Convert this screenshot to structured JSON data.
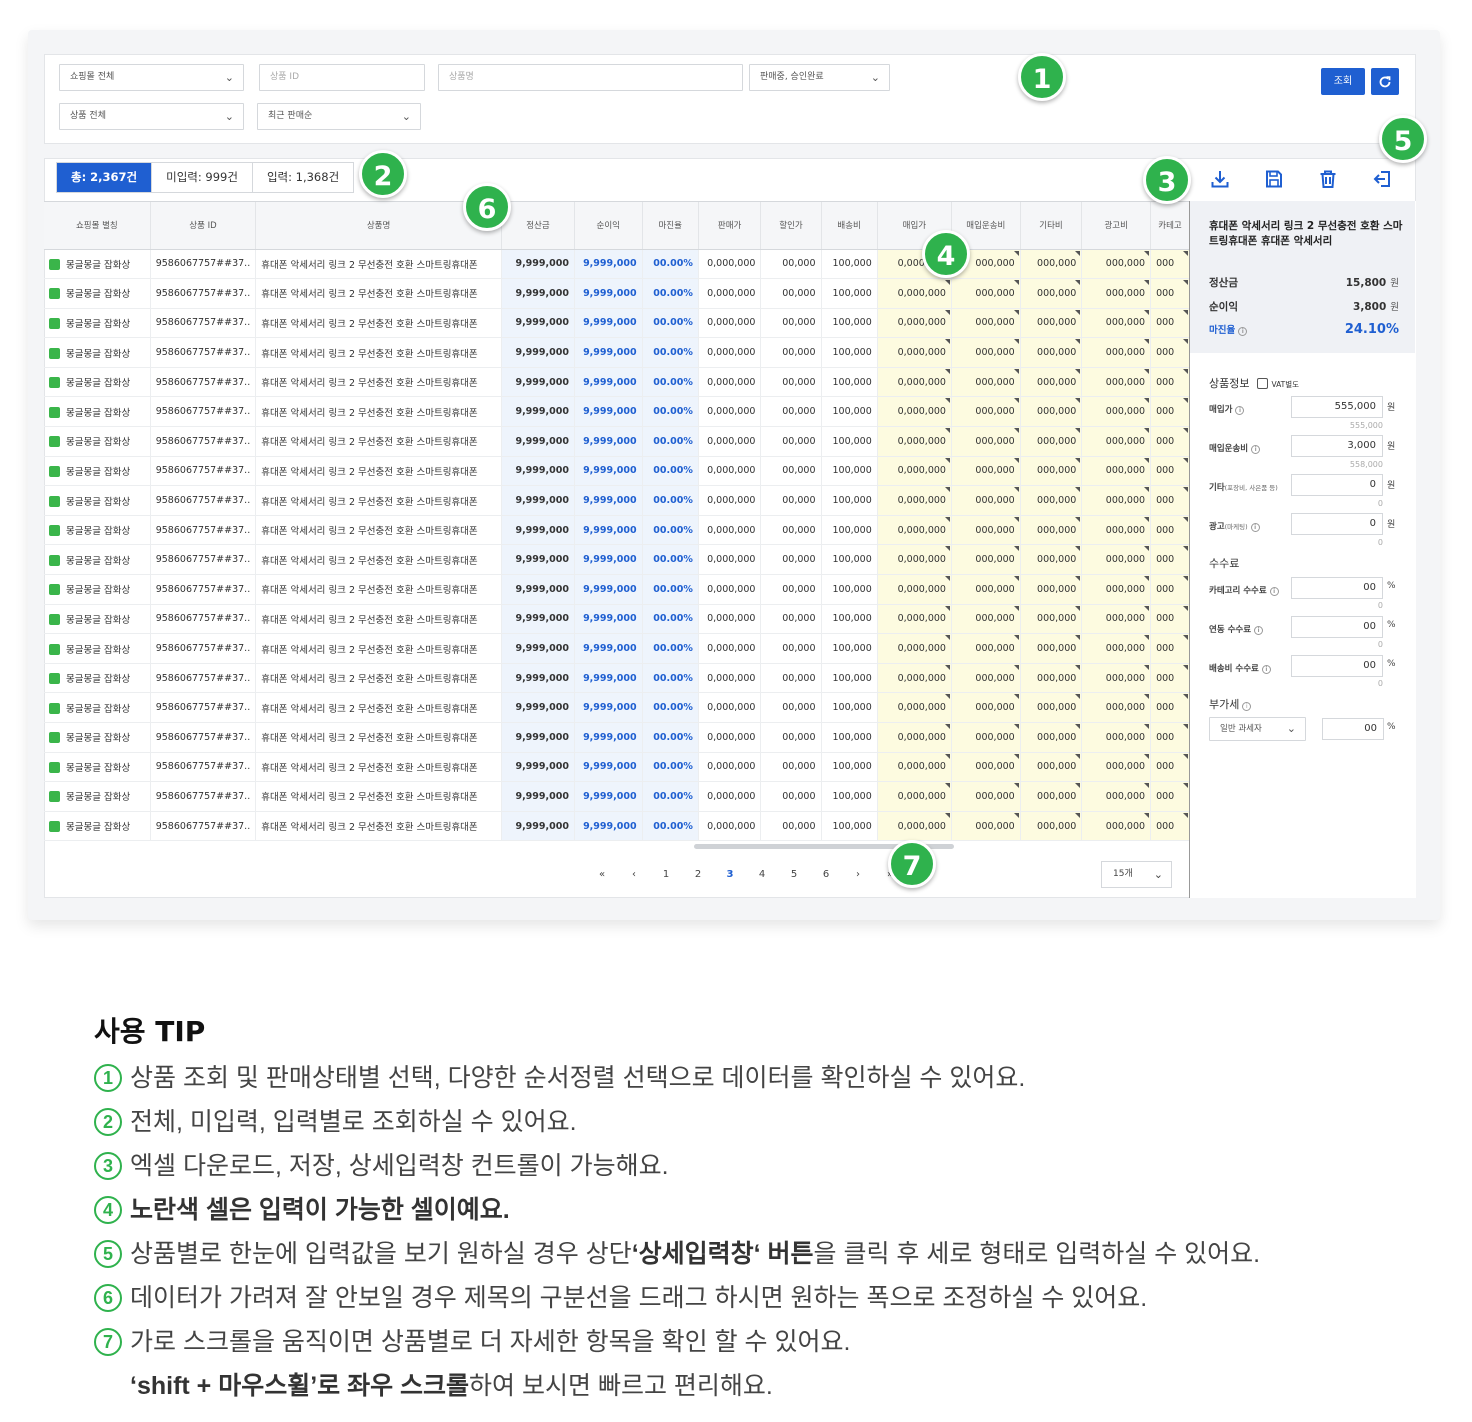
{
  "filters": {
    "mall_select": "쇼핑몰 전체",
    "product_id_placeholder": "상품 ID",
    "product_name_placeholder": "상품명",
    "status_select": "판매중, 승인완료",
    "product_select": "상품 전체",
    "sort_select": "최근 판매순",
    "search_button": "조회"
  },
  "tabs": [
    {
      "label": "총: 2,367건"
    },
    {
      "label": "미입력: 999건"
    },
    {
      "label": "입력: 1,368건"
    }
  ],
  "toolbar_icons": [
    "download-icon",
    "save-icon",
    "trash-icon",
    "detail-panel-toggle-icon"
  ],
  "table": {
    "headers": [
      "쇼핑몰 별칭",
      "상품 ID",
      "상품명",
      "정산금",
      "순이익",
      "마진율",
      "판매가",
      "할인가",
      "배송비",
      "매입가",
      "매입운송비",
      "기타비",
      "광고비",
      "카테고"
    ],
    "row": {
      "shop": "몽글몽글 잡화상",
      "pid": "9586067757##37..",
      "name": "휴대폰 악세서리 링크 2 무선충전 호환 스마트링휴대폰",
      "settle": "9,999,000",
      "profit": "9,999,000",
      "margin": "00.00%",
      "price": "0,000,000",
      "discount": "00,000",
      "ship": "100,000",
      "buy": "0,000,000",
      "buyship": "000,000",
      "etc": "000,000",
      "ad": "000,000",
      "cat": "000"
    },
    "row_count": 20
  },
  "pager": {
    "first": "«",
    "prev": "‹",
    "pages": [
      "1",
      "2",
      "3",
      "4",
      "5",
      "6"
    ],
    "current": "3",
    "next": "›",
    "last": "»",
    "page_size": "15개"
  },
  "detail": {
    "title": "휴대폰 악세서리 링크 2 무선충전 호환 스마트링휴대폰 휴대폰 악세서리",
    "settle_label": "정산금",
    "settle_value": "15,800",
    "settle_unit": "원",
    "profit_label": "순이익",
    "profit_value": "3,800",
    "profit_unit": "원",
    "margin_label": "마진율",
    "margin_value": "24.10%",
    "product_info_label": "상품정보",
    "vat_label": "VAT별도",
    "buy_label": "매입가",
    "buy_value": "555,000",
    "buy_sub": "555,000",
    "buy_unit": "원",
    "buyship_label": "매입운송비",
    "buyship_value": "3,000",
    "buyship_sub": "558,000",
    "buyship_unit": "원",
    "etc_label": "기타",
    "etc_small": "(포장비, 사은품 등)",
    "etc_value": "0",
    "etc_sub": "0",
    "etc_unit": "원",
    "ad_label": "광고",
    "ad_small": "(마케팅)",
    "ad_value": "0",
    "ad_sub": "0",
    "ad_unit": "원",
    "fee_label": "수수료",
    "cat_fee_label": "카테고리 수수료",
    "cat_fee_value": "00",
    "cat_fee_sub": "0",
    "cat_fee_unit": "%",
    "link_fee_label": "연동 수수료",
    "link_fee_value": "00",
    "link_fee_sub": "0",
    "link_fee_unit": "%",
    "ship_fee_label": "배송비 수수료",
    "ship_fee_value": "00",
    "ship_fee_sub": "0",
    "ship_fee_unit": "%",
    "vat_section_label": "부가세",
    "tax_type": "일반 과세자",
    "vat_value": "00",
    "vat_unit": "%"
  },
  "badges": [
    "1",
    "2",
    "3",
    "4",
    "5",
    "6",
    "7"
  ],
  "tip": {
    "title": "사용 TIP",
    "n1": "1",
    "n2": "2",
    "n3": "3",
    "n4": "4",
    "n5": "5",
    "n6": "6",
    "n7": "7",
    "l1": "상품 조회 및 판매상태별 선택, 다양한 순서정렬 선택으로 데이터를 확인하실 수 있어요.",
    "l2": "전체, 미입력, 입력별로 조회하실 수 있어요.",
    "l3": "엑셀 다운로드, 저장, 상세입력창 컨트롤이 가능해요.",
    "l4": "노란색 셀은 입력이 가능한 셀이예요.",
    "l5a": "상품별로 한눈에 입력값을 보기 원하실 경우 상단",
    "l5b": "‘상세입력창‘ 버튼",
    "l5c": "을 클릭 후 세로 형태로 입력하실 수 있어요.",
    "l6": "데이터가 가려져 잘 안보일 경우 제목의 구분선을 드래그 하시면 원하는 폭으로 조정하실 수 있어요.",
    "l7": "가로 스크롤을 움직이면 상품별로 더 자세한 항목을 확인 할 수 있어요.",
    "l8a": "‘shift + 마우스휠’로 좌우 스크롤",
    "l8b": "하여 보시면 빠르고 편리해요."
  }
}
